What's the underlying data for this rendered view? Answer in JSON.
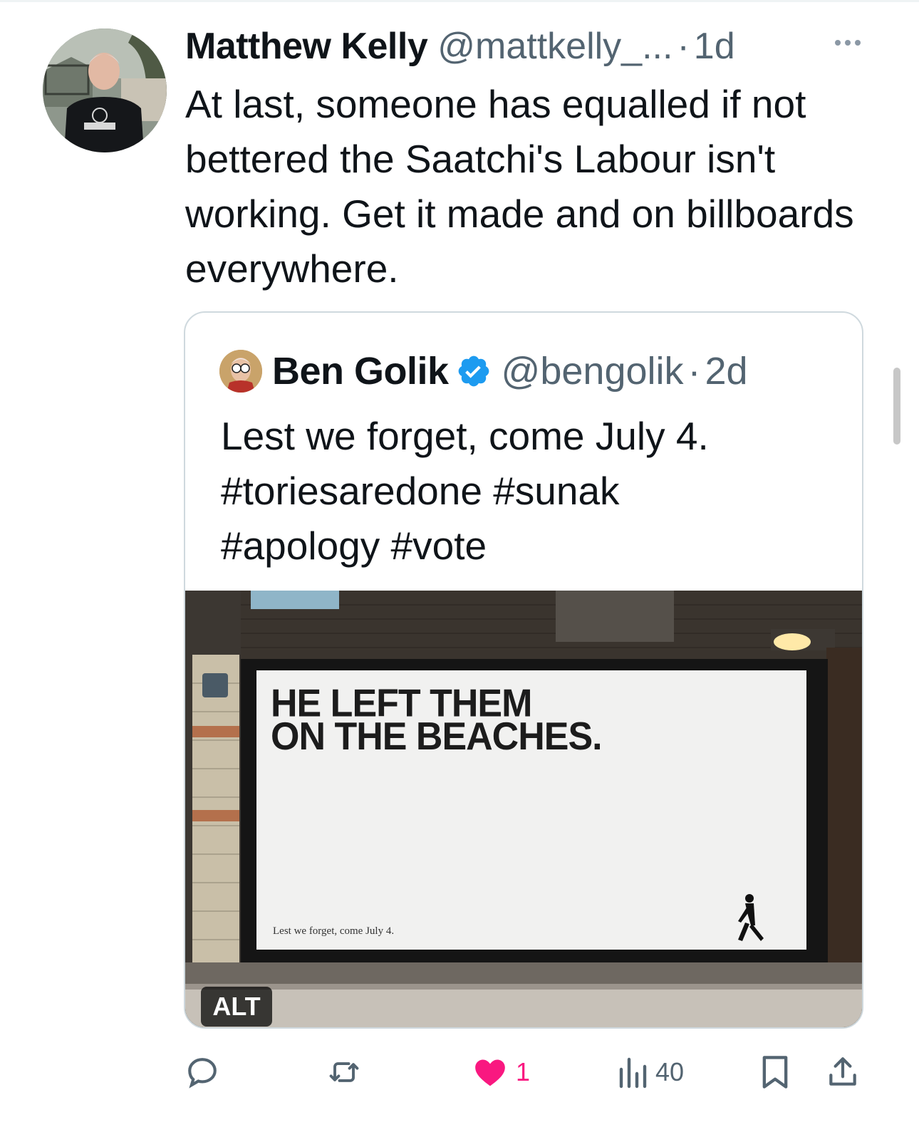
{
  "tweet": {
    "author_name": "Matthew Kelly",
    "author_handle": "@mattkelly_...",
    "separator": "·",
    "timestamp": "1d",
    "text": "At last, someone has equalled if not bettered the Saatchi's Labour isn't working. Get it made and on billboards everywhere."
  },
  "quoted_tweet": {
    "author_name": "Ben Golik",
    "author_handle": "@bengolik",
    "separator": "·",
    "timestamp": "2d",
    "verified": true,
    "text_line1": "Lest we forget, come July 4.",
    "text_line2": "#toriesaredone #sunak",
    "text_line3": "#apology #vote",
    "media": {
      "headline_line1": "HE LEFT THEM",
      "headline_line2": "ON THE BEACHES.",
      "tagline": "Lest we forget, come July 4.",
      "alt_label": "ALT"
    }
  },
  "actions": {
    "reply_count": "",
    "retweet_count": "",
    "like_count": "1",
    "views_count": "40"
  },
  "colors": {
    "text": "#0f1419",
    "secondary": "#536471",
    "verified": "#1d9bf0",
    "like": "#f91880",
    "border": "#cfd9de"
  },
  "icons": [
    "more-icon",
    "verified-icon",
    "reply-icon",
    "retweet-icon",
    "like-icon",
    "views-icon",
    "bookmark-icon",
    "share-icon"
  ]
}
